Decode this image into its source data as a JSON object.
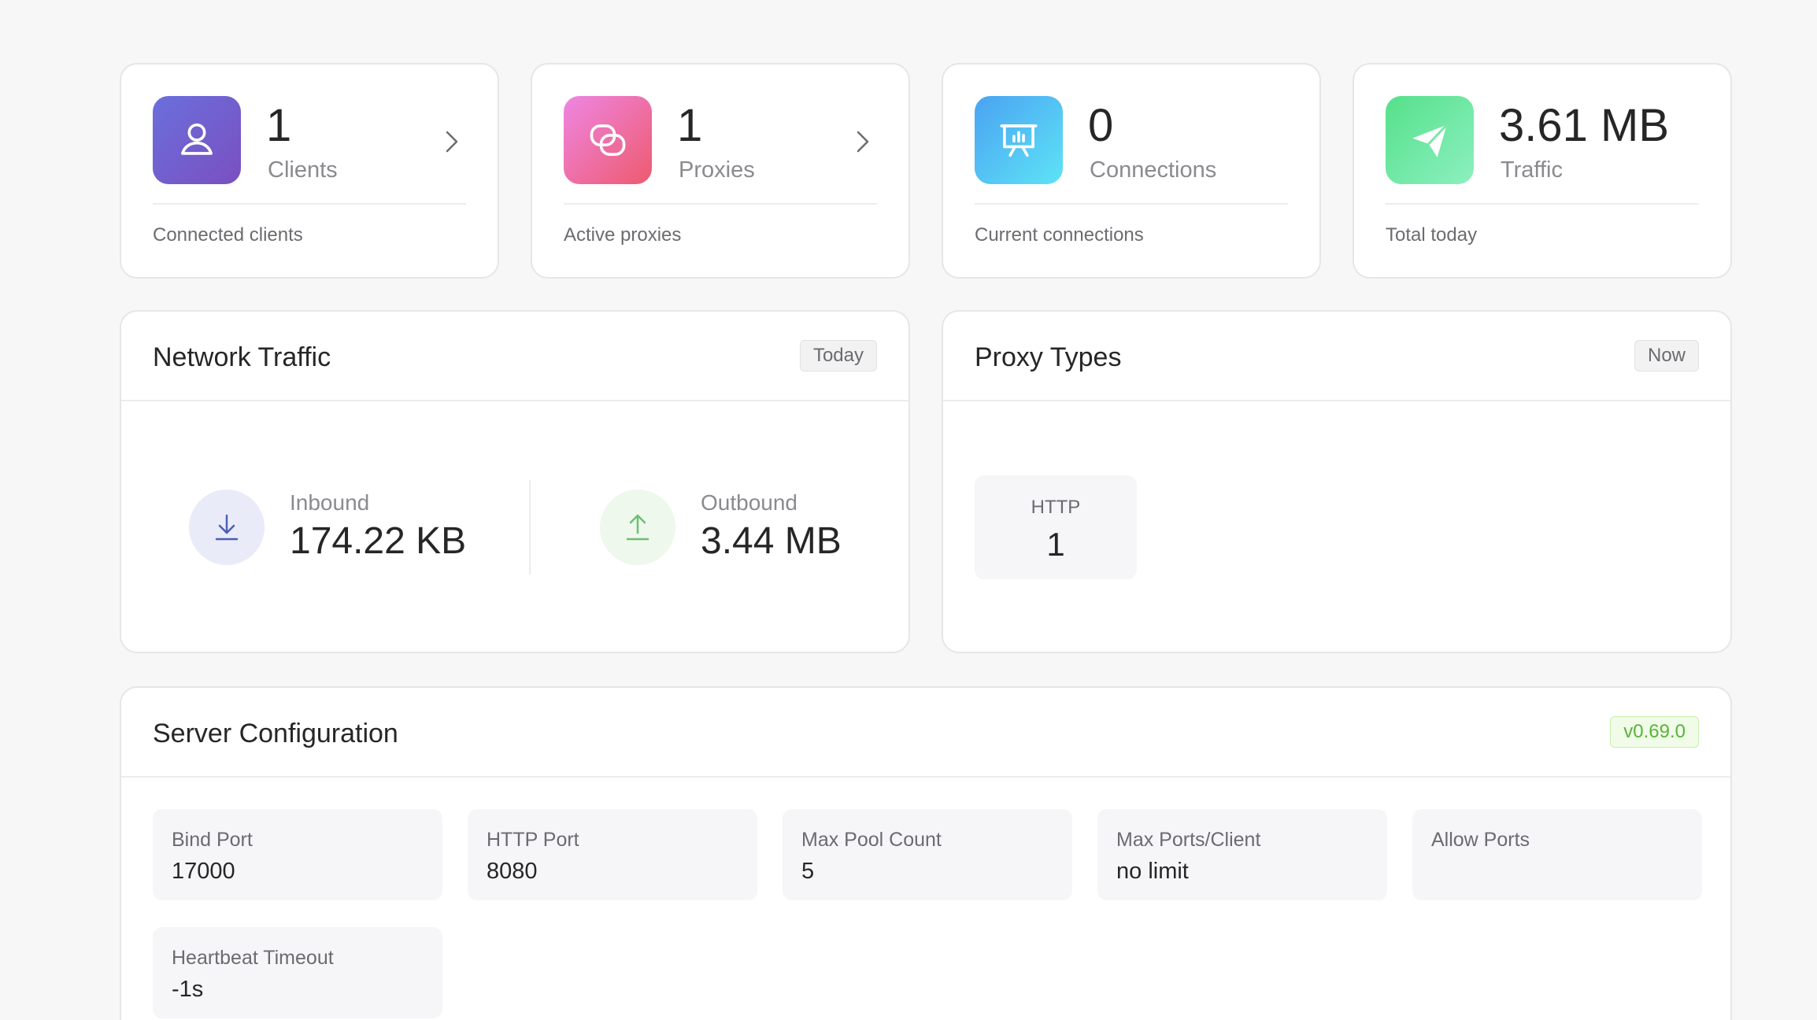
{
  "stats": [
    {
      "value": "1",
      "label": "Clients",
      "desc": "Connected clients",
      "icon": "user-icon"
    },
    {
      "value": "1",
      "label": "Proxies",
      "desc": "Active proxies",
      "icon": "link-icon"
    },
    {
      "value": "0",
      "label": "Connections",
      "desc": "Current connections",
      "icon": "presentation-chart-icon"
    },
    {
      "value": "3.61 MB",
      "label": "Traffic",
      "desc": "Total today",
      "icon": "paper-plane-icon"
    }
  ],
  "network_traffic": {
    "title": "Network Traffic",
    "tag": "Today",
    "inbound_label": "Inbound",
    "inbound_value": "174.22 KB",
    "outbound_label": "Outbound",
    "outbound_value": "3.44 MB"
  },
  "proxy_types": {
    "title": "Proxy Types",
    "tag": "Now",
    "items": [
      {
        "name": "HTTP",
        "count": "1"
      }
    ]
  },
  "server_config": {
    "title": "Server Configuration",
    "version": "v0.69.0",
    "items": [
      {
        "label": "Bind Port",
        "value": "17000"
      },
      {
        "label": "HTTP Port",
        "value": "8080"
      },
      {
        "label": "Max Pool Count",
        "value": "5"
      },
      {
        "label": "Max Ports/Client",
        "value": "no limit"
      },
      {
        "label": "Allow Ports",
        "value": ""
      },
      {
        "label": "Heartbeat Timeout",
        "value": "-1s"
      }
    ]
  },
  "colors": {
    "clients_gradient": [
      "#6b6fdc",
      "#7a4fc0"
    ],
    "proxies_gradient": [
      "#ee86e2",
      "#ee5a6e"
    ],
    "connections_gradient": [
      "#4aa3f2",
      "#5ee3f6"
    ],
    "traffic_gradient": [
      "#55e08a",
      "#8df0c0"
    ],
    "inbound_accent": "#4a5fb5",
    "outbound_accent": "#6cc070",
    "version_tag": "#58b43a"
  }
}
